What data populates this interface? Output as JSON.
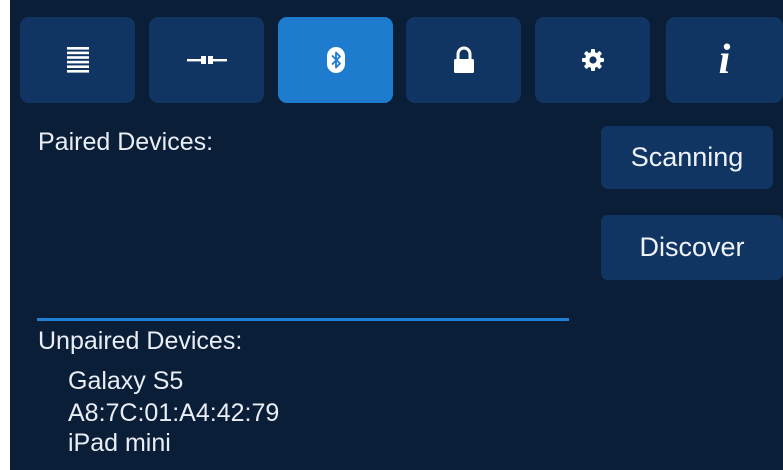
{
  "tabs": [
    {
      "id": "log",
      "icon": "list-icon",
      "active": false
    },
    {
      "id": "connection",
      "icon": "cable-connector-icon",
      "active": false
    },
    {
      "id": "bluetooth",
      "icon": "bluetooth-icon",
      "active": true
    },
    {
      "id": "security",
      "icon": "lock-icon",
      "active": false
    },
    {
      "id": "settings",
      "icon": "gear-icon",
      "active": false
    },
    {
      "id": "info",
      "icon": "info-icon",
      "glyph": "i",
      "active": false
    }
  ],
  "paired": {
    "label": "Paired Devices:"
  },
  "actions": {
    "scanning_label": "Scanning",
    "discover_label": "Discover"
  },
  "unpaired": {
    "label": "Unpaired Devices:",
    "items": [
      "Galaxy S5",
      "A8:7C:01:A4:42:79",
      "iPad mini"
    ]
  },
  "colors": {
    "background": "#0b1e37",
    "tab": "#113562",
    "tab_active": "#1e7ccf",
    "accent_line": "#1f7fd4",
    "text": "#e9eef6"
  }
}
